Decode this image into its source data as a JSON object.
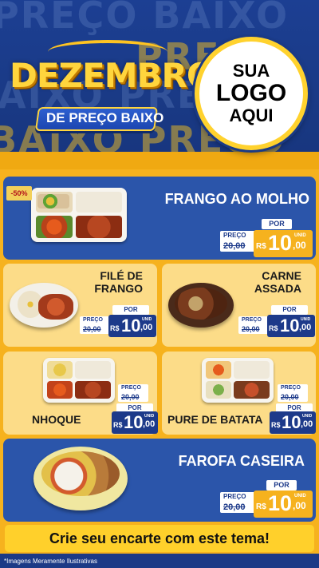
{
  "header": {
    "bg_words": [
      "PREÇO BAIXO",
      "BAIXO PREÇO",
      "PREÇO",
      "BAIXO PREÇO"
    ],
    "title_main": "DEZEMBRO",
    "title_sub": "DE PREÇO BAIXO",
    "logo": {
      "line1": "SUA",
      "line2": "LOGO",
      "line3": "AQUI"
    }
  },
  "discount_badge": "-50%",
  "price_labels": {
    "preco": "PREÇO",
    "por": "POR",
    "currency": "R$",
    "unid": "UNID"
  },
  "items": [
    {
      "name": "FRANGO AO MOLHO",
      "old_price": "20,00",
      "new_price_int": "10",
      "new_price_cents": ",00"
    },
    {
      "name_line1": "FILÉ DE",
      "name_line2": "FRANGO",
      "old_price": "20,00",
      "new_price_int": "10",
      "new_price_cents": ",00"
    },
    {
      "name_line1": "CARNE",
      "name_line2": "ASSADA",
      "old_price": "20,00",
      "new_price_int": "10",
      "new_price_cents": ",00"
    },
    {
      "name": "NHOQUE",
      "old_price": "20,00",
      "new_price_int": "10",
      "new_price_cents": ",00"
    },
    {
      "name": "PURE DE BATATA",
      "old_price": "20,00",
      "new_price_int": "10",
      "new_price_cents": ",00"
    },
    {
      "name": "FAROFA CASEIRA",
      "old_price": "20,00",
      "new_price_int": "10",
      "new_price_cents": ",00"
    }
  ],
  "banner": "Crie seu encarte com este tema!",
  "footnote": "*Imagens Meramente Ilustrativas",
  "colors": {
    "brand_blue": "#1c3f93",
    "card_blue": "#2b55aa",
    "gold": "#f6b21e",
    "light_card": "#fcdc88",
    "price_navy": "#1d3a8a"
  }
}
